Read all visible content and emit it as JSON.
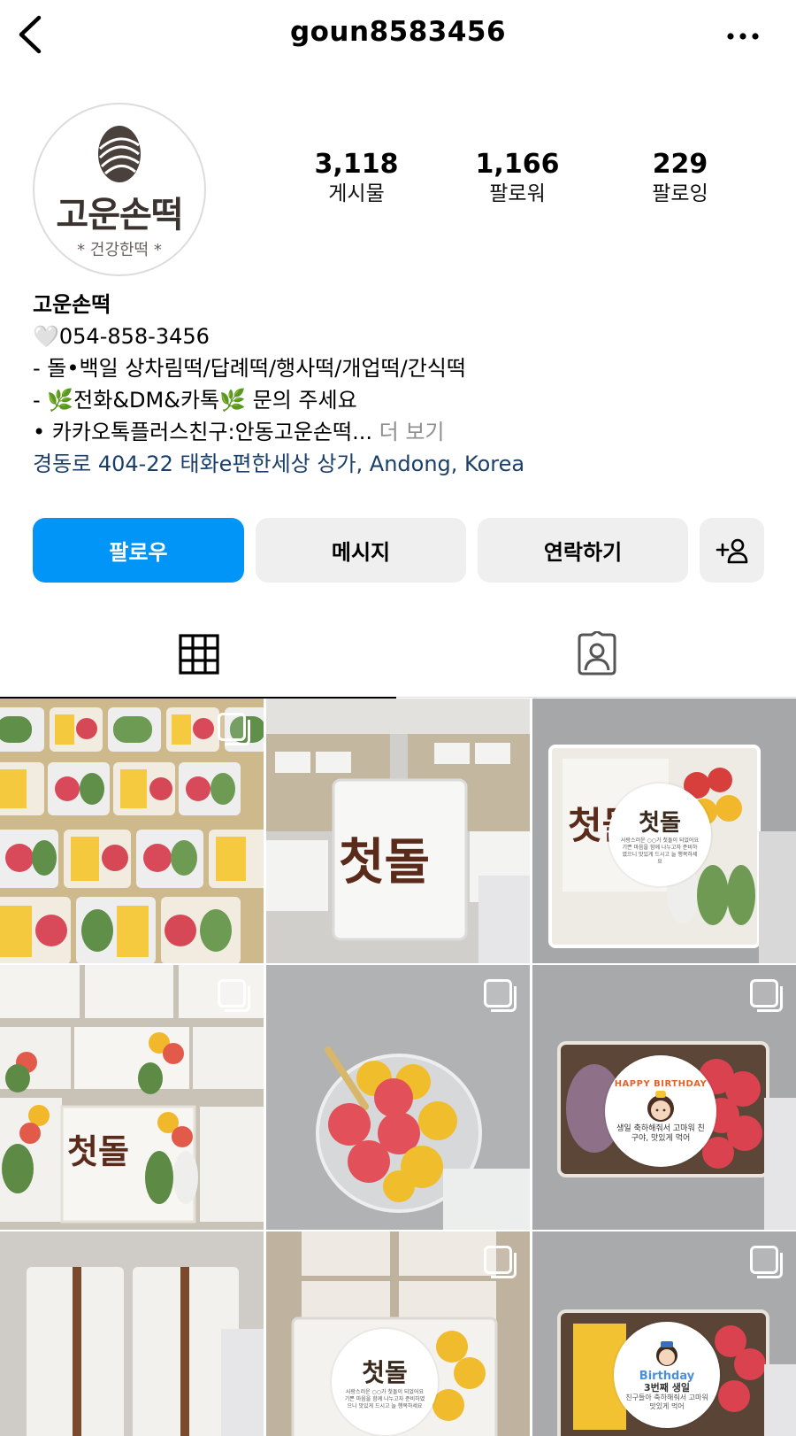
{
  "header": {
    "username": "goun8583456",
    "back_icon": "chevron-left-icon",
    "more_icon": "more-horizontal-icon"
  },
  "profile": {
    "avatar_name": "고운손떡",
    "avatar_sub": "* 건강한떡 *",
    "stats": [
      {
        "value": "3,118",
        "label": "게시물"
      },
      {
        "value": "1,166",
        "label": "팔로워"
      },
      {
        "value": "229",
        "label": "팔로잉"
      }
    ]
  },
  "bio": {
    "name": "고운손떡",
    "phone": "🤍054-858-3456",
    "line1": "- 돌•백일 상차림떡/답례떡/행사떡/개업떡/간식떡",
    "line2": "- 🌿전화&DM&카톡🌿 문의 주세요",
    "line3": "• 카카오톡플러스친구:안동고운손떡...",
    "more": "더 보기",
    "location": "경동로 404-22 태화e편한세상 상가, Andong, Korea"
  },
  "actions": {
    "follow": "팔로우",
    "message": "메시지",
    "contact": "연락하기",
    "add_person_icon": "add-person-icon"
  },
  "tabs": {
    "grid_icon": "grid-icon",
    "tagged_icon": "tagged-person-icon"
  },
  "posts": {
    "cake_text": "첫돌",
    "sticker_title": "첫돌",
    "sticker_small": "사랑스러운 ○○가 첫돌이 되었어요 기쁜 마음을 함께 나누고자 준비하였으니 맛있게 드시고 늘 행복하세요",
    "birthday_title": "HAPPY BIRTHDAY",
    "birthday_msg": "생일 축하해줘서 고마워 친구야, 맛있게 먹어",
    "birthday2_title": "Birthday",
    "birthday2_msg": "3번째 생일",
    "birthday2_msg2": "친구들아 축하해줘서 고마워 맛있게 먹어"
  },
  "colors": {
    "primary": "#0095f6",
    "button_bg": "#efefef",
    "location": "#1b3f6b",
    "muted": "#8e8e8e"
  }
}
